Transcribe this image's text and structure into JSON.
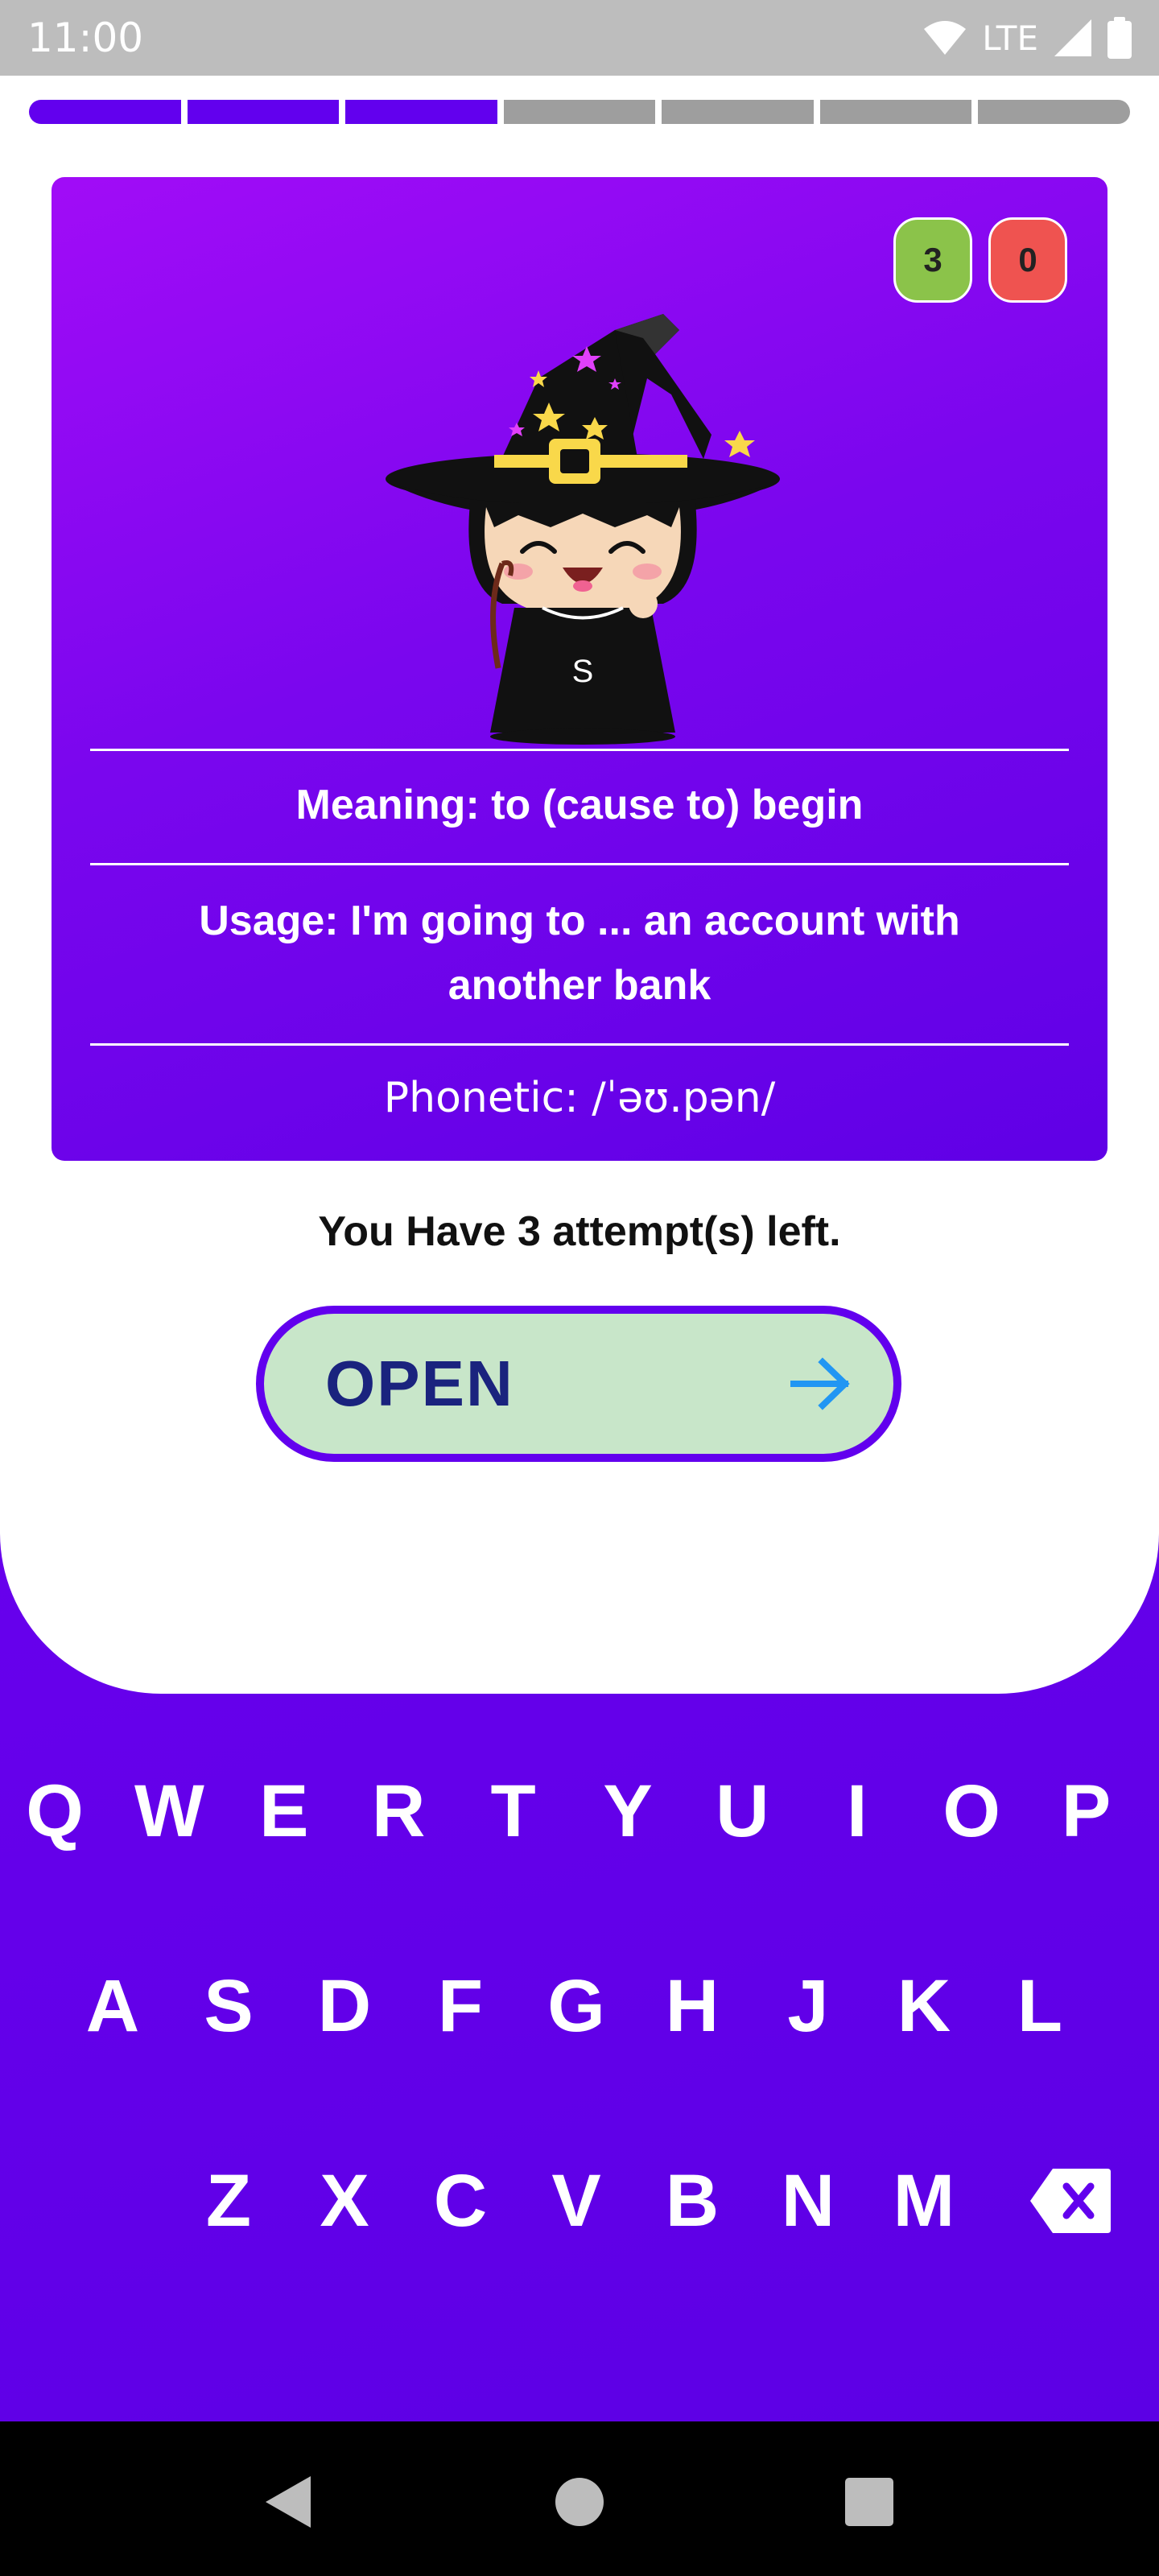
{
  "status_bar": {
    "time": "11:00",
    "network": "LTE"
  },
  "progress": {
    "segments_total": 7,
    "segments_completed": 3
  },
  "card": {
    "score_correct": "3",
    "score_wrong": "0",
    "mascot_letter": "S",
    "meaning": "Meaning: to (cause to) begin",
    "usage_line1": "Usage: I'm going to ... an account with",
    "usage_line2": "another bank",
    "phonetic": "Phonetic: /ˈəʊ.pən/"
  },
  "attempts_text": "You Have 3 attempt(s) left.",
  "answer": {
    "value": "OPEN",
    "submit_icon": "arrow-right-icon"
  },
  "keyboard": {
    "row1": [
      "Q",
      "W",
      "E",
      "R",
      "T",
      "Y",
      "U",
      "I",
      "O",
      "P"
    ],
    "row2": [
      "A",
      "S",
      "D",
      "F",
      "G",
      "H",
      "J",
      "K",
      "L"
    ],
    "row3": [
      "Z",
      "X",
      "C",
      "V",
      "B",
      "N",
      "M"
    ],
    "backspace_icon": "backspace-icon"
  },
  "colors": {
    "accent": "#6200ee",
    "correct": "#8bc34a",
    "wrong": "#ef5350",
    "answer_bg": "#c8e6c9",
    "answer_text": "#1a237e",
    "arrow": "#2196f3"
  },
  "nav": {
    "back_icon": "back-triangle-icon",
    "home_icon": "home-circle-icon",
    "recents_icon": "recents-square-icon"
  }
}
